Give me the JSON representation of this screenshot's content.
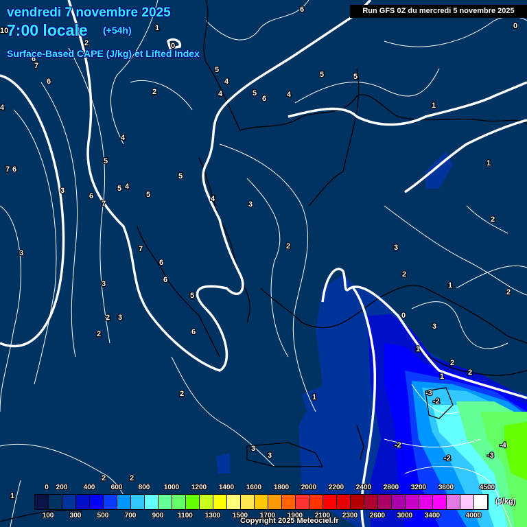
{
  "header": {
    "date": "vendredi 7 novembre 2025",
    "time": "7:00 locale",
    "lead": "(+54h)",
    "parameter": "Surface-Based CAPE (J/kg) et Lifted Index",
    "run": "Run GFS 0Z du mercredi 5 novembre 2025"
  },
  "colors": {
    "background": "#003262",
    "li_zero_line": "#ffffff",
    "coastline": "#000000",
    "title": "#33f0ff"
  },
  "contour_labels": [
    "6",
    "1",
    "0",
    "0",
    "10",
    "6",
    "7",
    "2",
    "5",
    "4",
    "5",
    "6",
    "4",
    "5",
    "5",
    "2",
    "4",
    "1",
    "6",
    "4",
    "4",
    "5",
    "7",
    "6",
    "5",
    "1",
    "3",
    "5",
    "4",
    "6",
    "7",
    "5",
    "4",
    "3",
    "2",
    "3",
    "7",
    "6",
    "2",
    "3",
    "6",
    "2",
    "1",
    "3",
    "2",
    "5",
    "2",
    "3",
    "0",
    "2",
    "3",
    "6",
    "1",
    "2",
    "2",
    "1",
    "-3",
    "-2",
    "2",
    "1",
    "3",
    "3",
    "-2",
    "-2",
    "-3",
    "-4",
    "2",
    "2",
    "1"
  ],
  "legend": {
    "unit": "(J/kg)",
    "top_labels": [
      "0",
      "200",
      "400",
      "600",
      "800",
      "1000",
      "1200",
      "1400",
      "1600",
      "1800",
      "2000",
      "2200",
      "2400",
      "2800",
      "3200",
      "3600",
      "4500"
    ],
    "bottom_labels": [
      "100",
      "300",
      "500",
      "700",
      "900",
      "1100",
      "1300",
      "1500",
      "1700",
      "1900",
      "2100",
      "2300",
      "2600",
      "3000",
      "3400",
      "4000"
    ],
    "swatches": [
      "#0a1446",
      "#003262",
      "#00349a",
      "#0010c8",
      "#0000ff",
      "#0a3cff",
      "#0096ff",
      "#32c8ff",
      "#64ffff",
      "#64ff96",
      "#64ff64",
      "#64ff00",
      "#c8ff1e",
      "#ffff00",
      "#ffff78",
      "#ffe650",
      "#ffc800",
      "#ff9b00",
      "#ff6400",
      "#ff3232",
      "#ff3200",
      "#ff0000",
      "#e60000",
      "#b40000",
      "#aa0032",
      "#aa0064",
      "#aa00aa",
      "#c800c8",
      "#e600e6",
      "#ff00ff",
      "#e678e6",
      "#ffc8ff",
      "#ffffff"
    ]
  },
  "footer": {
    "copyright": "Copyright 2025 Meteociel.fr"
  }
}
